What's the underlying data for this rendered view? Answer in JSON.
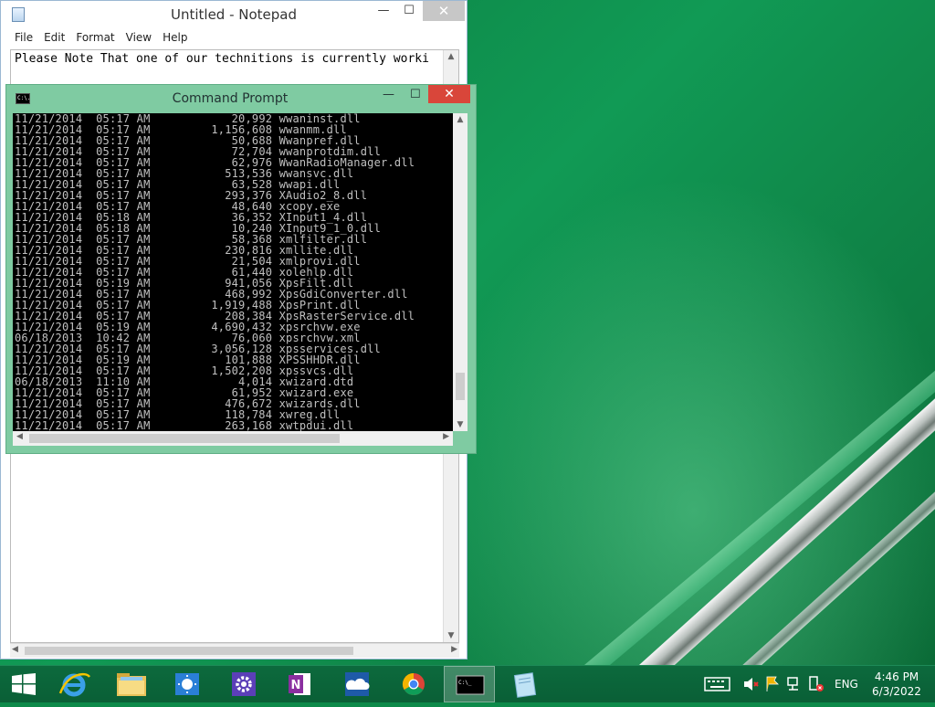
{
  "notepad": {
    "title": "Untitled - Notepad",
    "menu": [
      "File",
      "Edit",
      "Format",
      "View",
      "Help"
    ],
    "text": "Please Note That one of our technitions is currently worki",
    "controls": {
      "minimize": "—",
      "maximize": "☐",
      "close": "✕"
    }
  },
  "cmd": {
    "title": "Command Prompt",
    "icon_text": "C:\\.",
    "controls": {
      "minimize": "—",
      "maximize": "☐",
      "close": "✕"
    },
    "rows": [
      {
        "date": "11/21/2014",
        "time": "05:17 AM",
        "size": "20,992",
        "name": "wwaninst.dll"
      },
      {
        "date": "11/21/2014",
        "time": "05:17 AM",
        "size": "1,156,608",
        "name": "wwanmm.dll"
      },
      {
        "date": "11/21/2014",
        "time": "05:17 AM",
        "size": "50,688",
        "name": "Wwanpref.dll"
      },
      {
        "date": "11/21/2014",
        "time": "05:17 AM",
        "size": "72,704",
        "name": "wwanprotdim.dll"
      },
      {
        "date": "11/21/2014",
        "time": "05:17 AM",
        "size": "62,976",
        "name": "WwanRadioManager.dll"
      },
      {
        "date": "11/21/2014",
        "time": "05:17 AM",
        "size": "513,536",
        "name": "wwansvc.dll"
      },
      {
        "date": "11/21/2014",
        "time": "05:17 AM",
        "size": "63,528",
        "name": "wwapi.dll"
      },
      {
        "date": "11/21/2014",
        "time": "05:17 AM",
        "size": "293,376",
        "name": "XAudio2_8.dll"
      },
      {
        "date": "11/21/2014",
        "time": "05:17 AM",
        "size": "48,640",
        "name": "xcopy.exe"
      },
      {
        "date": "11/21/2014",
        "time": "05:18 AM",
        "size": "36,352",
        "name": "XInput1_4.dll"
      },
      {
        "date": "11/21/2014",
        "time": "05:18 AM",
        "size": "10,240",
        "name": "XInput9_1_0.dll"
      },
      {
        "date": "11/21/2014",
        "time": "05:17 AM",
        "size": "58,368",
        "name": "xmlfilter.dll"
      },
      {
        "date": "11/21/2014",
        "time": "05:17 AM",
        "size": "230,816",
        "name": "xmllite.dll"
      },
      {
        "date": "11/21/2014",
        "time": "05:17 AM",
        "size": "21,504",
        "name": "xmlprovi.dll"
      },
      {
        "date": "11/21/2014",
        "time": "05:17 AM",
        "size": "61,440",
        "name": "xolehlp.dll"
      },
      {
        "date": "11/21/2014",
        "time": "05:19 AM",
        "size": "941,056",
        "name": "XpsFilt.dll"
      },
      {
        "date": "11/21/2014",
        "time": "05:17 AM",
        "size": "468,992",
        "name": "XpsGdiConverter.dll"
      },
      {
        "date": "11/21/2014",
        "time": "05:17 AM",
        "size": "1,919,488",
        "name": "XpsPrint.dll"
      },
      {
        "date": "11/21/2014",
        "time": "05:17 AM",
        "size": "208,384",
        "name": "XpsRasterService.dll"
      },
      {
        "date": "11/21/2014",
        "time": "05:19 AM",
        "size": "4,690,432",
        "name": "xpsrchvw.exe"
      },
      {
        "date": "06/18/2013",
        "time": "10:42 AM",
        "size": "76,060",
        "name": "xpsrchvw.xml"
      },
      {
        "date": "11/21/2014",
        "time": "05:17 AM",
        "size": "3,056,128",
        "name": "xpsservices.dll"
      },
      {
        "date": "11/21/2014",
        "time": "05:19 AM",
        "size": "101,888",
        "name": "XPSSHHDR.dll"
      },
      {
        "date": "11/21/2014",
        "time": "05:17 AM",
        "size": "1,502,208",
        "name": "xpssvcs.dll"
      },
      {
        "date": "06/18/2013",
        "time": "11:10 AM",
        "size": "4,014",
        "name": "xwizard.dtd"
      },
      {
        "date": "11/21/2014",
        "time": "05:17 AM",
        "size": "61,952",
        "name": "xwizard.exe"
      },
      {
        "date": "11/21/2014",
        "time": "05:17 AM",
        "size": "476,672",
        "name": "xwizards.dll"
      },
      {
        "date": "11/21/2014",
        "time": "05:17 AM",
        "size": "118,784",
        "name": "xwreg.dll"
      },
      {
        "date": "11/21/2014",
        "time": "05:17 AM",
        "size": "263,168",
        "name": "xwtpdui.dll"
      }
    ]
  },
  "taskbar": {
    "apps": [
      {
        "name": "start-icon"
      },
      {
        "name": "internet-explorer-icon"
      },
      {
        "name": "file-explorer-icon"
      },
      {
        "name": "weather-icon"
      },
      {
        "name": "settings-icon"
      },
      {
        "name": "onenote-icon"
      },
      {
        "name": "onedrive-icon"
      },
      {
        "name": "chrome-icon"
      },
      {
        "name": "command-prompt-icon"
      },
      {
        "name": "notepad-icon"
      }
    ],
    "language": "ENG",
    "time": "4:46 PM",
    "date": "6/3/2022"
  },
  "colors": {
    "taskbar": "#0a5f36",
    "cmd_frame": "#7fcba2",
    "close_red": "#d9463a",
    "console_text": "#c0c0c0"
  }
}
